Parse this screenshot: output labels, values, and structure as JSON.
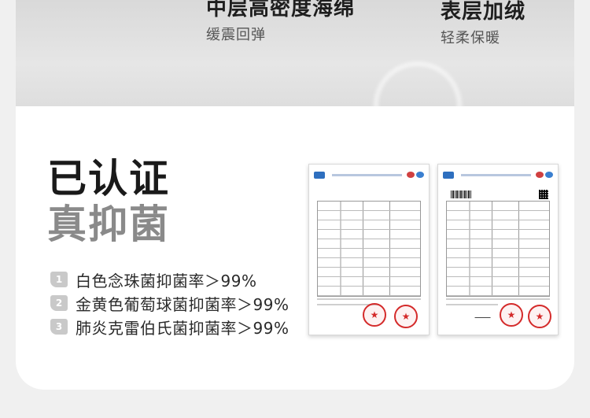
{
  "features": [
    {
      "title": "中层高密度海绵",
      "subtitle": "缓震回弹"
    },
    {
      "title": "表层加绒",
      "subtitle": "轻柔保暖"
    }
  ],
  "headline": {
    "line1": "已认证",
    "line2": "真抑菌"
  },
  "claims": [
    {
      "num": "1",
      "text": "白色念珠菌抑菌率＞99%"
    },
    {
      "num": "2",
      "text": "金黄色葡萄球菌抑菌率＞99%"
    },
    {
      "num": "3",
      "text": "肺炎克雷伯氏菌抑菌率＞99%"
    }
  ],
  "colors": {
    "stamp": "#d42a2a",
    "logo": "#2e6fbf",
    "headline_dark": "#1a1a1a",
    "headline_gray": "#8a8a8a"
  }
}
